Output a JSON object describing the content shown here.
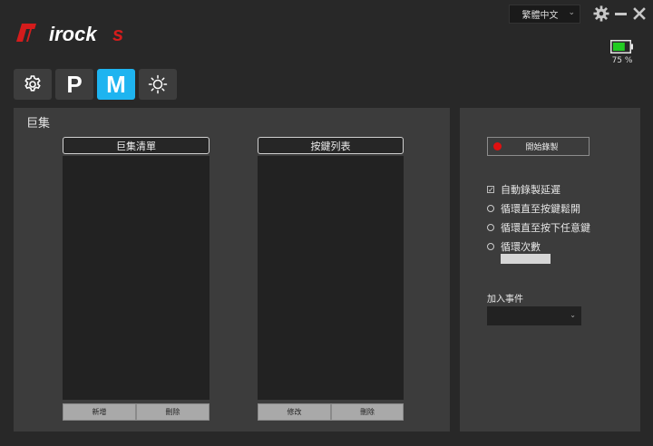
{
  "brand": {
    "name": "irocks",
    "accent": "#e02020"
  },
  "window": {
    "language": "繁體中文",
    "settings_icon": "gear-icon",
    "minimize_icon": "minimize-icon",
    "close_icon": "close-icon"
  },
  "battery": {
    "level_percent": 75,
    "text": "75 %",
    "color": "#22cc22"
  },
  "tabs": [
    {
      "icon": "gear-icon",
      "label": ""
    },
    {
      "icon": "",
      "label": "P"
    },
    {
      "icon": "",
      "label": "M",
      "active": true
    },
    {
      "icon": "brightness-icon",
      "label": ""
    }
  ],
  "macro": {
    "title": "巨集",
    "macro_list": {
      "header": "巨集清單",
      "add_label": "新增",
      "delete_label": "刪除"
    },
    "key_list": {
      "header": "按鍵列表",
      "edit_label": "修改",
      "delete_label": "刪除"
    }
  },
  "recording": {
    "record_button": "開始錄製",
    "options": [
      {
        "type": "checkbox",
        "label": "自動錄製延遲",
        "checked": true
      },
      {
        "type": "radio",
        "label": "循環直至按鍵鬆開",
        "checked": false
      },
      {
        "type": "radio",
        "label": "循環直至按下任意鍵",
        "checked": false
      },
      {
        "type": "radio",
        "label": "循環次數",
        "checked": false
      }
    ],
    "loop_count_value": "",
    "add_event_label": "加入事件",
    "add_event_value": ""
  }
}
